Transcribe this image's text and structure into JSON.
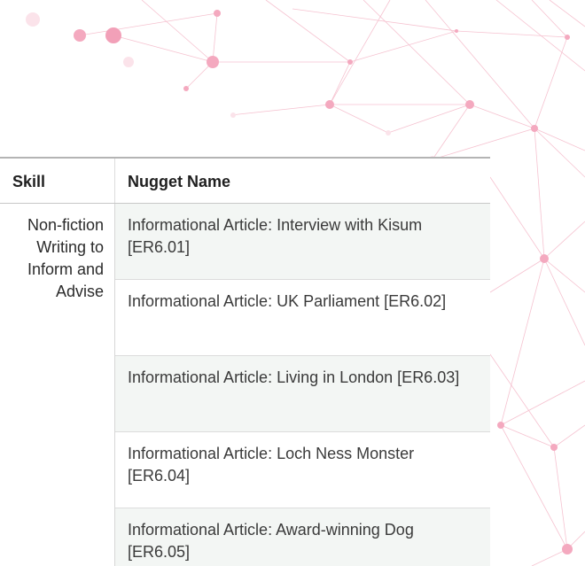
{
  "table": {
    "headers": {
      "skill": "Skill",
      "nugget_name": "Nugget Name"
    },
    "skill": "Non-fiction Writing to Inform and Advise",
    "skill_lines": [
      "Non-fiction",
      "Writing to",
      "Inform and",
      "Advise"
    ],
    "rows": [
      {
        "nugget": "Informational Article: Interview with Kisum [ER6.01]"
      },
      {
        "nugget": "Informational Article: UK Parliament [ER6.02]"
      },
      {
        "nugget": "Informational Article: Living in London [ER6.03]"
      },
      {
        "nugget": "Informational Article: Loch Ness Monster [ER6.04]"
      },
      {
        "nugget": "Informational Article: Award-winning Dog [ER6.05]"
      }
    ]
  },
  "colors": {
    "decoration_pink": "#f2a7bd",
    "row_stripe": "#f3f6f4",
    "border": "#dcdcdc"
  }
}
